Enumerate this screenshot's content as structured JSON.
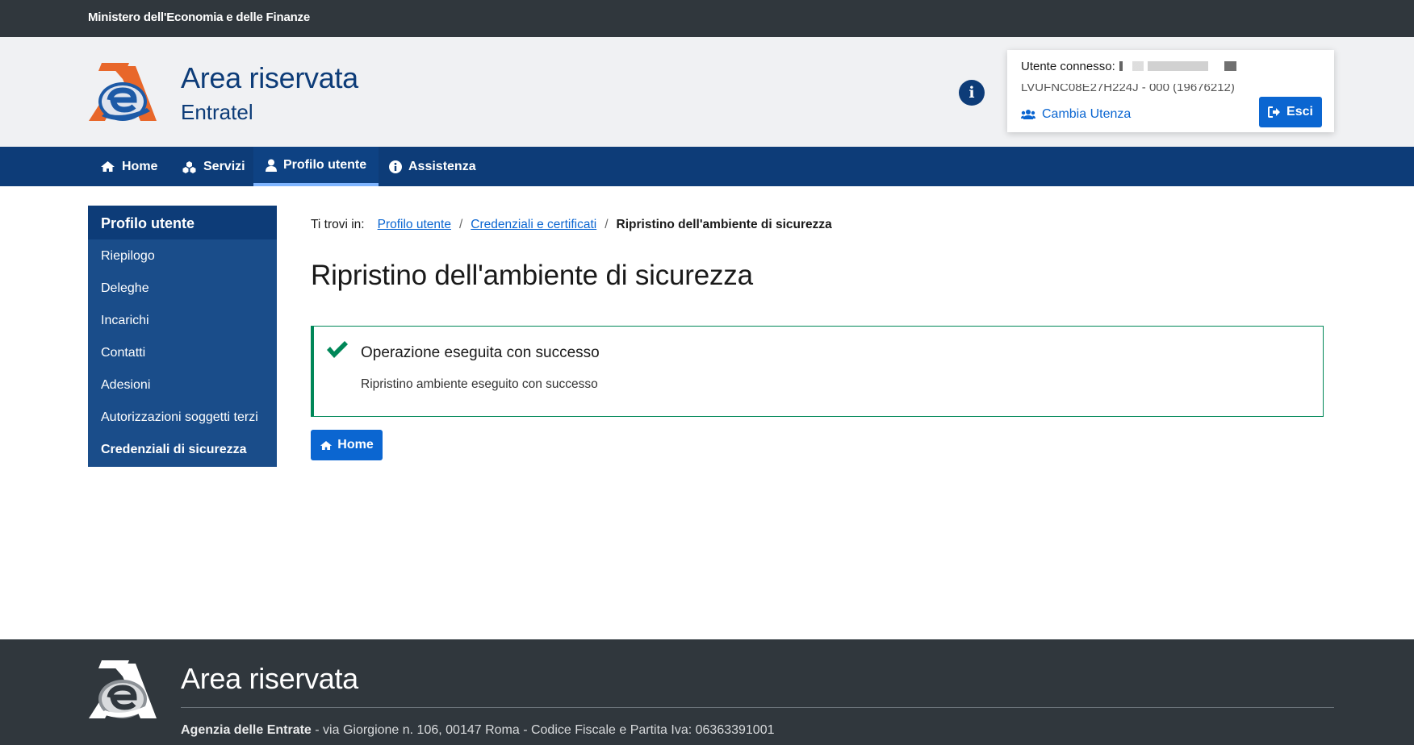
{
  "topbar": {
    "ministry": "Ministero dell'Economia e delle Finanze"
  },
  "header": {
    "title": "Area riservata",
    "subtitle": "Entratel"
  },
  "user": {
    "connected_label": "Utente connesso:",
    "code": "LVUFNC08E27H224J - 000 (19676212)",
    "switch_label": "Cambia Utenza",
    "logout_label": "Esci"
  },
  "nav": {
    "items": [
      {
        "label": "Home",
        "icon": "home-icon"
      },
      {
        "label": "Servizi",
        "icon": "cubes-icon"
      },
      {
        "label": "Profilo utente",
        "icon": "user-icon",
        "active": true
      },
      {
        "label": "Assistenza",
        "icon": "info-circle-icon"
      }
    ]
  },
  "sidebar": {
    "heading": "Profilo utente",
    "items": [
      {
        "label": "Riepilogo"
      },
      {
        "label": "Deleghe"
      },
      {
        "label": "Incarichi"
      },
      {
        "label": "Contatti"
      },
      {
        "label": "Adesioni"
      },
      {
        "label": "Autorizzazioni soggetti terzi"
      },
      {
        "label": "Credenziali di sicurezza",
        "active": true
      }
    ]
  },
  "breadcrumb": {
    "prefix": "Ti trovi in:",
    "links": [
      "Profilo utente",
      "Credenziali e certificati"
    ],
    "separator": "/",
    "current": "Ripristino dell'ambiente di sicurezza"
  },
  "main": {
    "title": "Ripristino dell'ambiente di sicurezza",
    "alert": {
      "title": "Operazione eseguita con successo",
      "body": "Ripristino ambiente eseguito con successo"
    },
    "home_button": "Home"
  },
  "footer": {
    "title": "Area riservata",
    "agency": "Agenzia delle Entrate",
    "address": " - via Giorgione n. 106, 00147 Roma - Codice Fiscale e Partita Iva: 06363391001"
  },
  "colors": {
    "primary": "#0d3c78",
    "accent": "#0b66d1",
    "success": "#008758",
    "dark": "#30373d",
    "logo_orange": "#e8672a"
  }
}
